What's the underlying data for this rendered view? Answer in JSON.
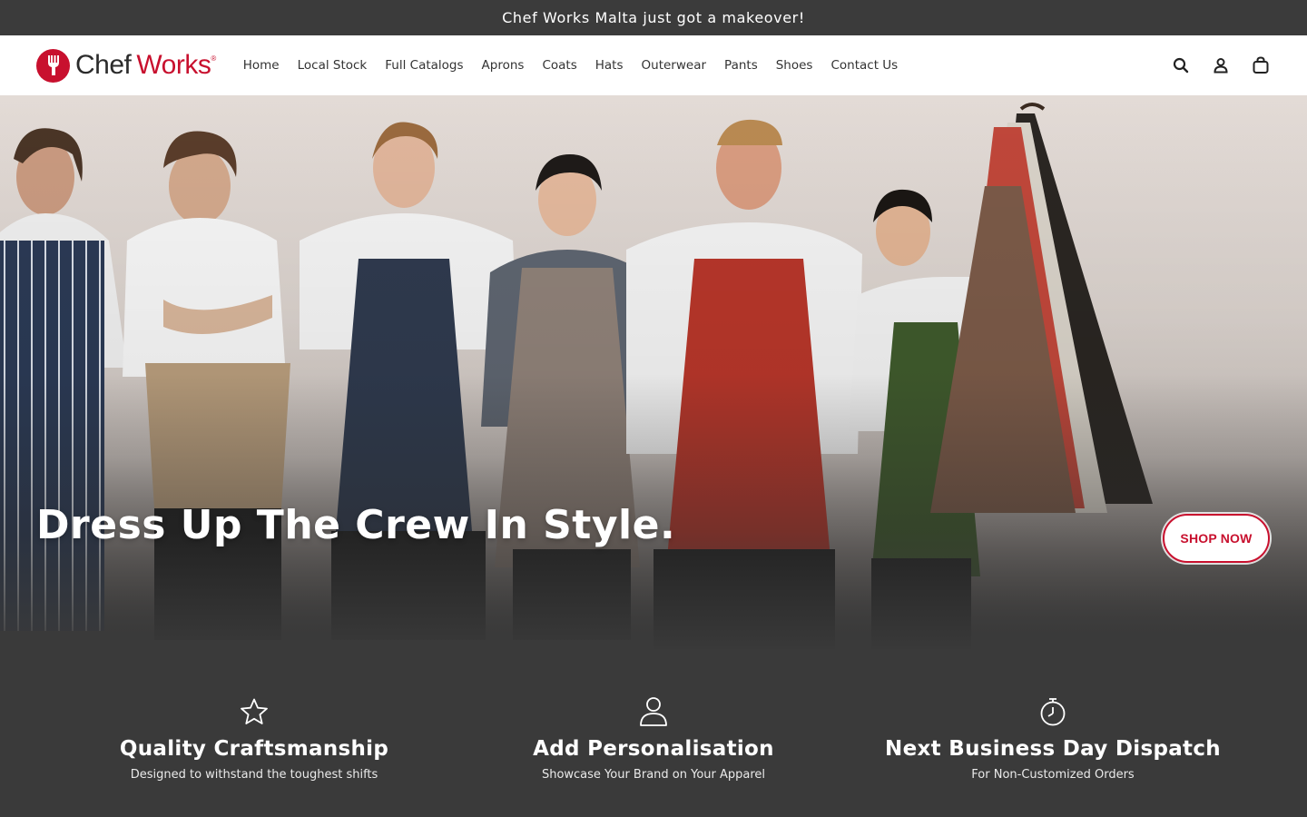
{
  "announcement": "Chef Works Malta just got a makeover!",
  "brand": {
    "name_part1": "Chef",
    "name_part2": "Works",
    "trademark": "®",
    "color": "#c8102e"
  },
  "nav": {
    "items": [
      "Home",
      "Local Stock",
      "Full Catalogs",
      "Aprons",
      "Coats",
      "Hats",
      "Outerwear",
      "Pants",
      "Shoes",
      "Contact Us"
    ]
  },
  "header_icons": [
    "search-icon",
    "account-icon",
    "cart-icon"
  ],
  "hero": {
    "title": "Dress Up The Crew In Style.",
    "cta": "SHOP NOW"
  },
  "features": [
    {
      "icon": "star-icon",
      "title": "Quality Craftsmanship",
      "subtitle": "Designed to withstand the toughest shifts"
    },
    {
      "icon": "user-icon",
      "title": "Add Personalisation",
      "subtitle": "Showcase Your Brand on Your Apparel"
    },
    {
      "icon": "stopwatch-icon",
      "title": "Next Business Day Dispatch",
      "subtitle": "For Non-Customized Orders"
    }
  ]
}
